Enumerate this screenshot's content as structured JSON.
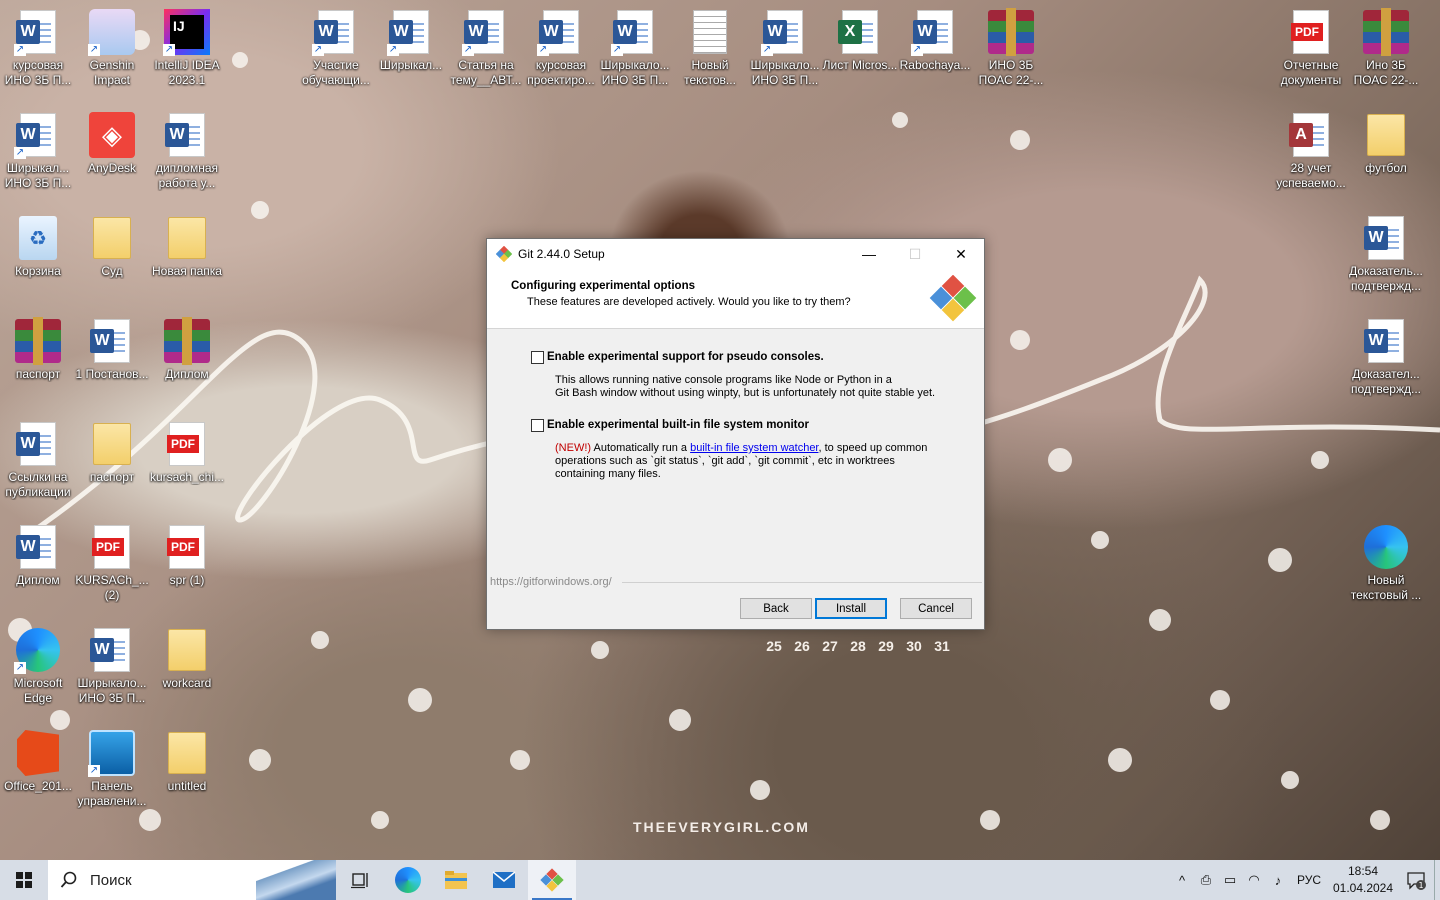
{
  "desktop": {
    "watermark": "THEEVERYGIRL.COM",
    "calendar_days": [
      "25",
      "26",
      "27",
      "28",
      "29",
      "30",
      "31"
    ],
    "icons": [
      {
        "label": "курсовая ИНО 3Б П...",
        "type": "word"
      },
      {
        "label": "Genshin Impact",
        "type": "genshin"
      },
      {
        "label": "IntelliJ IDEA 2023.1",
        "type": "idea"
      },
      {
        "label": "Участие обучающи...",
        "type": "word"
      },
      {
        "label": "Ширыкал...",
        "type": "word"
      },
      {
        "label": "Статья на тему__АВТ...",
        "type": "word"
      },
      {
        "label": "курсовая проектиро...",
        "type": "word"
      },
      {
        "label": "Ширыкало... ИНО 3Б П...",
        "type": "word"
      },
      {
        "label": "Новый текстов...",
        "type": "txt"
      },
      {
        "label": "Ширыкало... ИНО 3Б П...",
        "type": "word"
      },
      {
        "label": "Лист Micros...",
        "type": "excel"
      },
      {
        "label": "Rabochaya...",
        "type": "word"
      },
      {
        "label": "ИНО 3Б ПОАС 22-...",
        "type": "rar"
      },
      {
        "label": "Отчетные документы",
        "type": "pdf"
      },
      {
        "label": "Ино 3Б ПОАС 22-...",
        "type": "rar"
      },
      {
        "label": "Ширыкал... ИНО 3Б П...",
        "type": "word"
      },
      {
        "label": "AnyDesk",
        "type": "anydesk"
      },
      {
        "label": "дипломная работа у...",
        "type": "word"
      },
      {
        "label": "28 учет успеваемо...",
        "type": "access"
      },
      {
        "label": "футбол",
        "type": "folder"
      },
      {
        "label": "Корзина",
        "type": "recycle"
      },
      {
        "label": "Суд",
        "type": "folder"
      },
      {
        "label": "Новая папка",
        "type": "folder"
      },
      {
        "label": "Доказатель... подтвержд...",
        "type": "word"
      },
      {
        "label": "паспорт",
        "type": "rar"
      },
      {
        "label": "1 Постанов...",
        "type": "word"
      },
      {
        "label": "Диплом",
        "type": "rar"
      },
      {
        "label": "Доказател... подтвержд...",
        "type": "word"
      },
      {
        "label": "Ссылки на публикации",
        "type": "word"
      },
      {
        "label": "паспорт",
        "type": "folder"
      },
      {
        "label": "kursach_chi...",
        "type": "pdf"
      },
      {
        "label": "Диплом",
        "type": "word"
      },
      {
        "label": "KURSACh_... (2)",
        "type": "pdf"
      },
      {
        "label": "spr (1)",
        "type": "pdf"
      },
      {
        "label": "Новый текстовый ...",
        "type": "edge"
      },
      {
        "label": "Microsoft Edge",
        "type": "edge"
      },
      {
        "label": "Ширыкало... ИНО 3Б П...",
        "type": "word"
      },
      {
        "label": "workcard",
        "type": "folder"
      },
      {
        "label": "Office_201...",
        "type": "office"
      },
      {
        "label": "Панель управлени...",
        "type": "intel"
      },
      {
        "label": "untitled",
        "type": "folder"
      }
    ]
  },
  "dialog": {
    "title": "Git 2.44.0 Setup",
    "heading": "Configuring experimental options",
    "subheading": "These features are developed actively. Would you like to try them?",
    "option1": {
      "label": "Enable experimental support for pseudo consoles.",
      "checked": false,
      "desc_line1": "This allows running native console programs like Node or Python in a",
      "desc_line2": "Git Bash window without using winpty, but is unfortunately not quite stable yet."
    },
    "option2": {
      "label": "Enable experimental built-in file system monitor",
      "checked": false,
      "desc_new": "(NEW!)",
      "desc_pre": " Automatically run a ",
      "desc_link": "built-in file system watcher",
      "desc_post": ", to speed up common",
      "desc_line2": "operations such as `git status`, `git add`, `git commit`, etc in worktrees",
      "desc_line3": "containing many files."
    },
    "footer_url": "https://gitforwindows.org/",
    "buttons": {
      "back": "Back",
      "install": "Install",
      "cancel": "Cancel"
    }
  },
  "taskbar": {
    "search_placeholder": "Поиск",
    "language": "РУС",
    "time": "18:54",
    "date": "01.04.2024",
    "notification_count": "1"
  }
}
